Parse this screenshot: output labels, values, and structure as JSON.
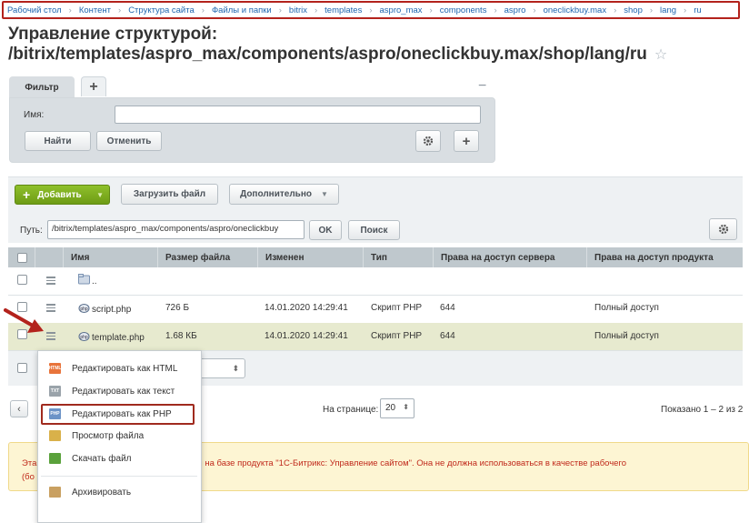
{
  "breadcrumb": [
    "Рабочий стол",
    "Контент",
    "Структура сайта",
    "Файлы и папки",
    "bitrix",
    "templates",
    "aspro_max",
    "components",
    "aspro",
    "oneclickbuy.max",
    "shop",
    "lang",
    "ru"
  ],
  "page": {
    "title_line1": "Управление структурой:",
    "title_line2": "/bitrix/templates/aspro_max/components/aspro/oneclickbuy.max/shop/lang/ru",
    "star_icon": "star-icon"
  },
  "filter": {
    "tab_label": "Фильтр",
    "add_tab": "+",
    "minimize": "−",
    "name_label": "Имя:",
    "name_value": "",
    "find_button": "Найти",
    "cancel_button": "Отменить",
    "settings_icon": "gear-icon",
    "add_icon": "plus-icon"
  },
  "toolbar": {
    "add_button": "Добавить",
    "upload_button": "Загрузить файл",
    "more_button": "Дополнительно",
    "path_label": "Путь:",
    "path_value": "/bitrix/templates/aspro_max/components/aspro/oneclickbuy",
    "ok_button": "OK",
    "search_button": "Поиск"
  },
  "table": {
    "columns": [
      "Имя",
      "Размер файла",
      "Изменен",
      "Тип",
      "Права на доступ сервера",
      "Права на доступ продукта"
    ],
    "rows": [
      {
        "name": "..",
        "size": "",
        "modified": "",
        "type": "",
        "server_rights": "",
        "product_rights": "",
        "icon": "folder-icon"
      },
      {
        "name": "script.php",
        "size": "726 Б",
        "modified": "14.01.2020 14:29:41",
        "type": "Скрипт PHP",
        "server_rights": "644",
        "product_rights": "Полный доступ",
        "icon": "php-file-icon"
      },
      {
        "name": "template.php",
        "size": "1.68 КБ",
        "modified": "14.01.2020 14:29:41",
        "type": "Скрипт PHP",
        "server_rights": "644",
        "product_rights": "Полный доступ",
        "icon": "php-file-icon"
      }
    ]
  },
  "pager": {
    "prev": "‹",
    "per_page_label": "На странице:",
    "per_page_value": "20",
    "shown": "Показано 1 – 2 из 2"
  },
  "notice": {
    "line1_start": "Эта",
    "line1_end": "ботки на базе продукта \"1С-Битрикс: Управление сайтом\". Она не должна использоваться в качестве рабочего",
    "line2_start": "(бо"
  },
  "context_menu": {
    "items": [
      {
        "label": "Редактировать как HTML",
        "icon": "html-edit-icon",
        "color": "#e8743b"
      },
      {
        "label": "Редактировать как текст",
        "icon": "text-edit-icon",
        "color": "#9aa3aa"
      },
      {
        "label": "Редактировать как PHP",
        "icon": "php-edit-icon",
        "color": "#6c93c7"
      },
      {
        "label": "Просмотр файла",
        "icon": "view-file-icon",
        "color": "#d9b14a"
      },
      {
        "label": "Скачать файл",
        "icon": "download-icon",
        "color": "#5aa13b"
      },
      {
        "label": "Архивировать",
        "icon": "archive-icon",
        "color": "#c9a061"
      }
    ]
  }
}
